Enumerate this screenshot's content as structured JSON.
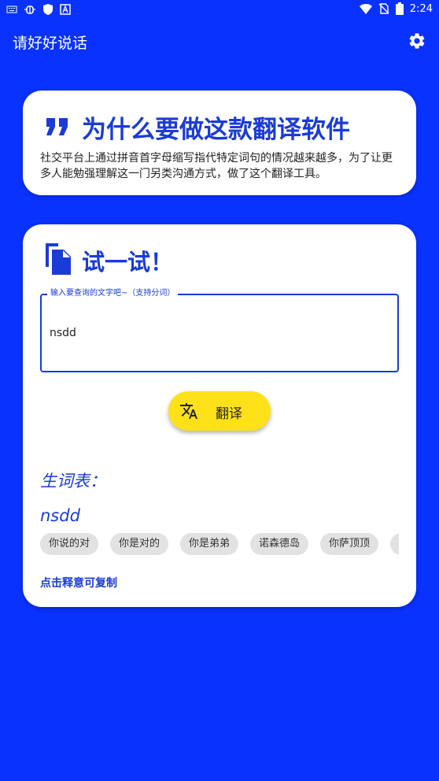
{
  "status_bar": {
    "time": "2:24",
    "left_icons": [
      "keyboard-icon",
      "bug-icon",
      "shield-icon",
      "a-box-icon"
    ],
    "right_icons": [
      "wifi-icon",
      "no-sim-icon",
      "battery-icon"
    ]
  },
  "app_bar": {
    "title": "请好好说话",
    "settings_icon": "gear-icon"
  },
  "about_card": {
    "icon": "quote-icon",
    "title": "为什么要做这款翻译软件",
    "body": "社交平台上通过拼音首字母缩写指代特定词句的情况越来越多，为了让更多人能勉强理解这一门另类沟通方式，做了这个翻译工具。"
  },
  "try_card": {
    "icon": "copy-icon",
    "title": "试一试！",
    "input": {
      "label": "输入要查询的文字吧~（支持分词）",
      "value": "nsdd"
    },
    "translate_button": {
      "icon": "translate-icon",
      "label": "翻译"
    },
    "vocab_title": "生词表：",
    "term": "nsdd",
    "chips": [
      "你说的对",
      "你是对的",
      "你是弟弟",
      "诺森德岛",
      "你萨顶顶",
      ""
    ],
    "copy_hint": "点击释意可复制"
  },
  "colors": {
    "background": "#0a32ff",
    "accent": "#1a3bd6",
    "button": "#ffe11a",
    "chip": "#e2e2e2"
  }
}
